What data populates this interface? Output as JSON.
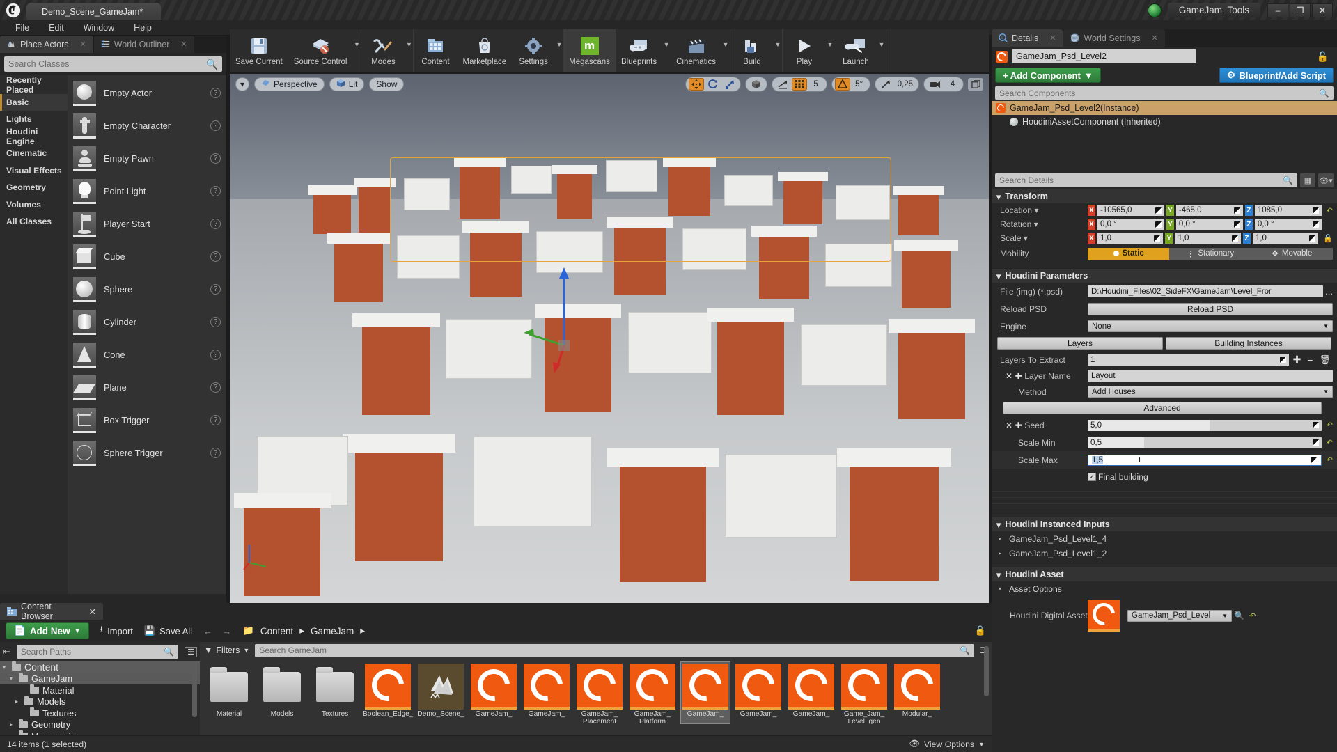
{
  "titlebar": {
    "project_tab": "Demo_Scene_GameJam*",
    "app_title": "GameJam_Tools",
    "minimize": "–",
    "maximize": "❐",
    "close": "✕"
  },
  "menubar": {
    "items": [
      "File",
      "Edit",
      "Window",
      "Help"
    ]
  },
  "left_panel": {
    "tabs": [
      {
        "label": "Place Actors",
        "icon": "place-actors-icon",
        "active": true
      },
      {
        "label": "World Outliner",
        "icon": "world-outliner-icon",
        "active": false
      }
    ],
    "search_placeholder": "Search Classes",
    "categories": [
      {
        "label": "Recently Placed",
        "selected": false
      },
      {
        "label": "Basic",
        "selected": true
      },
      {
        "label": "Lights",
        "selected": false
      },
      {
        "label": "Houdini Engine",
        "selected": false
      },
      {
        "label": "Cinematic",
        "selected": false
      },
      {
        "label": "Visual Effects",
        "selected": false
      },
      {
        "label": "Geometry",
        "selected": false
      },
      {
        "label": "Volumes",
        "selected": false
      },
      {
        "label": "All Classes",
        "selected": false
      }
    ],
    "actors": [
      {
        "label": "Empty Actor",
        "icon": "sphere-thumb"
      },
      {
        "label": "Empty Character",
        "icon": "character-thumb"
      },
      {
        "label": "Empty Pawn",
        "icon": "pawn-thumb"
      },
      {
        "label": "Point Light",
        "icon": "lightbulb-thumb"
      },
      {
        "label": "Player Start",
        "icon": "flag-thumb"
      },
      {
        "label": "Cube",
        "icon": "cube-thumb"
      },
      {
        "label": "Sphere",
        "icon": "sphere-thumb"
      },
      {
        "label": "Cylinder",
        "icon": "cylinder-thumb"
      },
      {
        "label": "Cone",
        "icon": "cone-thumb"
      },
      {
        "label": "Plane",
        "icon": "plane-thumb"
      },
      {
        "label": "Box Trigger",
        "icon": "box-trigger-thumb"
      },
      {
        "label": "Sphere Trigger",
        "icon": "sphere-trigger-thumb"
      }
    ]
  },
  "main_toolbar": {
    "groups": [
      {
        "items": [
          {
            "label": "Save Current",
            "icon": "save-icon",
            "caret": false
          },
          {
            "label": "Source Control",
            "icon": "source-control-icon",
            "caret": true
          }
        ]
      },
      {
        "items": [
          {
            "label": "Modes",
            "icon": "modes-icon",
            "caret": true
          }
        ]
      },
      {
        "items": [
          {
            "label": "Content",
            "icon": "content-icon",
            "caret": false
          },
          {
            "label": "Marketplace",
            "icon": "marketplace-icon",
            "caret": false
          },
          {
            "label": "Settings",
            "icon": "settings-icon",
            "caret": true
          },
          {
            "label": "Megascans",
            "icon": "megascans-icon",
            "caret": false,
            "highlight": true
          },
          {
            "label": "Blueprints",
            "icon": "blueprints-icon",
            "caret": true
          },
          {
            "label": "Cinematics",
            "icon": "cinematics-icon",
            "caret": true
          }
        ]
      },
      {
        "items": [
          {
            "label": "Build",
            "icon": "build-icon",
            "caret": true
          }
        ]
      },
      {
        "items": [
          {
            "label": "Play",
            "icon": "play-icon",
            "caret": true
          },
          {
            "label": "Launch",
            "icon": "launch-icon",
            "caret": true
          }
        ]
      }
    ]
  },
  "viewport": {
    "menu_caret": "▾",
    "perspective": "Perspective",
    "lit": "Lit",
    "show": "Show",
    "transform_modes": [
      "translate-icon",
      "rotate-icon",
      "scale-icon"
    ],
    "coord_icon": "world-space-icon",
    "snap_icon": "grid-snap-icon",
    "grid_snap_value": "5",
    "angle_icon": "angle-snap-icon",
    "angle_snap_value": "5°",
    "scale_icon": "scale-snap-icon",
    "scale_snap_value": "0,25",
    "camera_icon": "camera-speed-icon",
    "camera_speed": "4",
    "maximize_icon": "maximize-viewport-icon"
  },
  "details": {
    "tabs": [
      {
        "label": "Details",
        "icon": "details-icon",
        "active": true
      },
      {
        "label": "World Settings",
        "icon": "world-settings-icon",
        "active": false
      }
    ],
    "actor_name": "GameJam_Psd_Level2",
    "lock_icon": "lock-icon",
    "add_component": "+ Add Component",
    "blueprint_button": "Blueprint/Add Script",
    "search_components_placeholder": "Search Components",
    "components": [
      {
        "label": "GameJam_Psd_Level2(Instance)",
        "selected": true
      },
      {
        "label": "HoudiniAssetComponent (Inherited)",
        "selected": false
      }
    ],
    "search_details_placeholder": "Search Details",
    "transform": {
      "title": "Transform",
      "rows": [
        {
          "label": "Location",
          "x": "-10565,0",
          "y": "-465,0",
          "z": "1085,0"
        },
        {
          "label": "Rotation",
          "x": "0,0 °",
          "y": "0,0 °",
          "z": "0,0 °"
        },
        {
          "label": "Scale",
          "x": "1,0",
          "y": "1,0",
          "z": "1,0"
        }
      ],
      "mobility_label": "Mobility",
      "mobility": [
        {
          "label": "Static",
          "active": true
        },
        {
          "label": "Stationary",
          "active": false
        },
        {
          "label": "Movable",
          "active": false
        }
      ]
    },
    "houdini_parameters": {
      "title": "Houdini Parameters",
      "file_label": "File (img) (*.psd)",
      "file_value": "D:\\Houdini_Files\\02_SideFX\\GameJam\\Level_Fror",
      "file_browse": "...",
      "reload_label": "Reload PSD",
      "reload_button": "Reload PSD",
      "engine_label": "Engine",
      "engine_value": "None",
      "tab_layers": "Layers",
      "tab_building_instances": "Building Instances",
      "layers_to_extract_label": "Layers To Extract",
      "layers_to_extract_value": "1",
      "layer_name_label": "Layer Name",
      "layer_name_value": "Layout",
      "method_label": "Method",
      "method_value": "Add Houses",
      "advanced_button": "Advanced",
      "seed_label": "Seed",
      "seed_value": "5,0",
      "scale_min_label": "Scale Min",
      "scale_min_value": "0,5",
      "scale_max_label": "Scale Max",
      "scale_max_value": "1,5",
      "final_building_label": "Final building",
      "final_building_checked": true
    },
    "houdini_instanced_inputs": {
      "title": "Houdini Instanced Inputs",
      "items": [
        "GameJam_Psd_Level1_4",
        "GameJam_Psd_Level1_2"
      ]
    },
    "houdini_asset": {
      "title": "Houdini Asset",
      "asset_options_label": "Asset Options",
      "hda_label": "Houdini Digital Asset",
      "hda_value": "GameJam_Psd_Level"
    }
  },
  "content_browser": {
    "tab_label": "Content Browser",
    "tab_icon": "content-browser-icon",
    "add_new": "Add New",
    "import": "Import",
    "save_all": "Save All",
    "back_arrow": "←",
    "forward_arrow": "→",
    "breadcrumb": [
      "Content",
      "GameJam"
    ],
    "breadcrumb_sep": "▸",
    "search_paths_placeholder": "Search Paths",
    "tree": [
      {
        "label": "Content",
        "depth": 0,
        "arrow": "▾",
        "selected": false
      },
      {
        "label": "GameJam",
        "depth": 1,
        "arrow": "▾",
        "selected": true
      },
      {
        "label": "Material",
        "depth": 2,
        "arrow": "",
        "selected": false
      },
      {
        "label": "Models",
        "depth": 2,
        "arrow": "▸",
        "selected": false
      },
      {
        "label": "Textures",
        "depth": 2,
        "arrow": "",
        "selected": false
      },
      {
        "label": "Geometry",
        "depth": 1,
        "arrow": "▸",
        "selected": false
      },
      {
        "label": "Mannequin",
        "depth": 1,
        "arrow": "▸",
        "selected": false
      }
    ],
    "filters_label": "Filters",
    "asset_search_placeholder": "Search GameJam",
    "assets": [
      {
        "name": "Material",
        "type": "folder",
        "selected": false
      },
      {
        "name": "Models",
        "type": "folder",
        "selected": false
      },
      {
        "name": "Textures",
        "type": "folder",
        "selected": false
      },
      {
        "name": "Boolean_Edge_",
        "type": "hda",
        "selected": false
      },
      {
        "name": "Demo_Scene_",
        "type": "level",
        "selected": false
      },
      {
        "name": "GameJam_",
        "type": "hda",
        "selected": false
      },
      {
        "name": "GameJam_",
        "type": "hda",
        "selected": false
      },
      {
        "name": "GameJam_ Placement",
        "type": "hda",
        "selected": false
      },
      {
        "name": "GameJam_ Platform",
        "type": "hda",
        "selected": false
      },
      {
        "name": "GameJam_",
        "type": "hda",
        "selected": true
      },
      {
        "name": "GameJam_",
        "type": "hda",
        "selected": false
      },
      {
        "name": "GameJam_",
        "type": "hda",
        "selected": false
      },
      {
        "name": "Game_Jam_ Level_gen",
        "type": "hda",
        "selected": false
      },
      {
        "name": "Modular_",
        "type": "hda",
        "selected": false
      }
    ],
    "status": "14 items (1 selected)",
    "view_options": "View Options"
  }
}
